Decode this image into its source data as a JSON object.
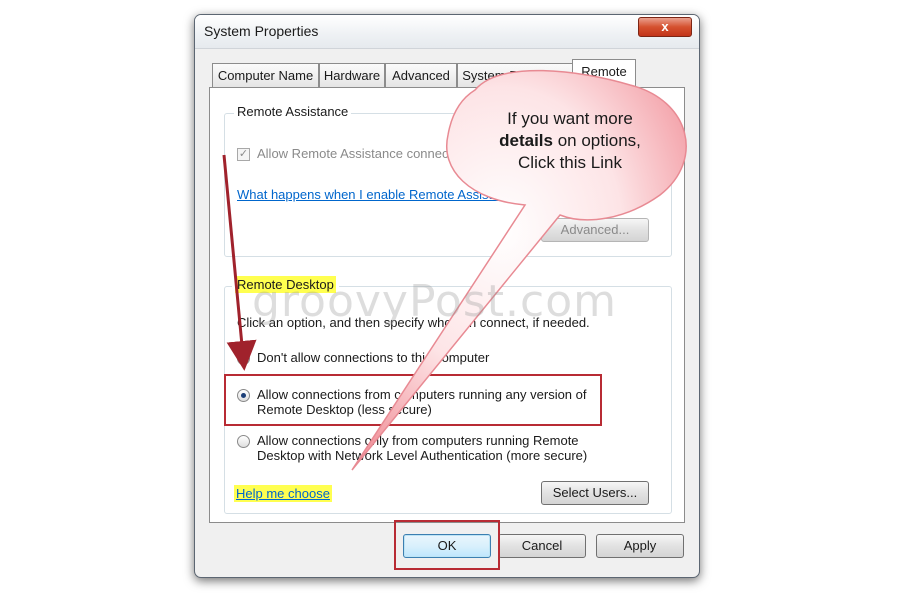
{
  "window": {
    "title": "System Properties",
    "close_glyph": "x"
  },
  "tabs": [
    {
      "label": "Computer Name",
      "active": false
    },
    {
      "label": "Hardware",
      "active": false
    },
    {
      "label": "Advanced",
      "active": false
    },
    {
      "label": "System Protection",
      "active": false
    },
    {
      "label": "Remote",
      "active": true
    }
  ],
  "remote_assistance": {
    "group_label": "Remote Assistance",
    "allow_checkbox_label": "Allow Remote Assistance connections to this computer",
    "allow_checked": true,
    "help_link": "What happens when I enable Remote Assistance?",
    "advanced_button": "Advanced..."
  },
  "remote_desktop": {
    "group_label": "Remote Desktop",
    "instructions": "Click an option, and then specify who can connect, if needed.",
    "options": [
      {
        "line1": "Don't allow connections to this computer",
        "line2": "",
        "checked": false
      },
      {
        "line1": "Allow connections from computers running any version of",
        "line2": "Remote Desktop (less secure)",
        "checked": true
      },
      {
        "line1": "Allow connections only from computers running Remote",
        "line2": "Desktop with Network Level Authentication (more secure)",
        "checked": false
      }
    ],
    "help_link": "Help me choose",
    "select_users_button": "Select Users..."
  },
  "footer": {
    "ok": "OK",
    "cancel": "Cancel",
    "apply": "Apply"
  },
  "annotation": {
    "callout_line1": "If you want more",
    "callout_bold": "details",
    "callout_line2_rest": " on options,",
    "callout_line3": "Click this Link",
    "watermark": "groovyPost.com"
  },
  "colors": {
    "highlight": "#ffff50",
    "annotation_red": "#b82b34",
    "link_blue": "#0066cc"
  }
}
